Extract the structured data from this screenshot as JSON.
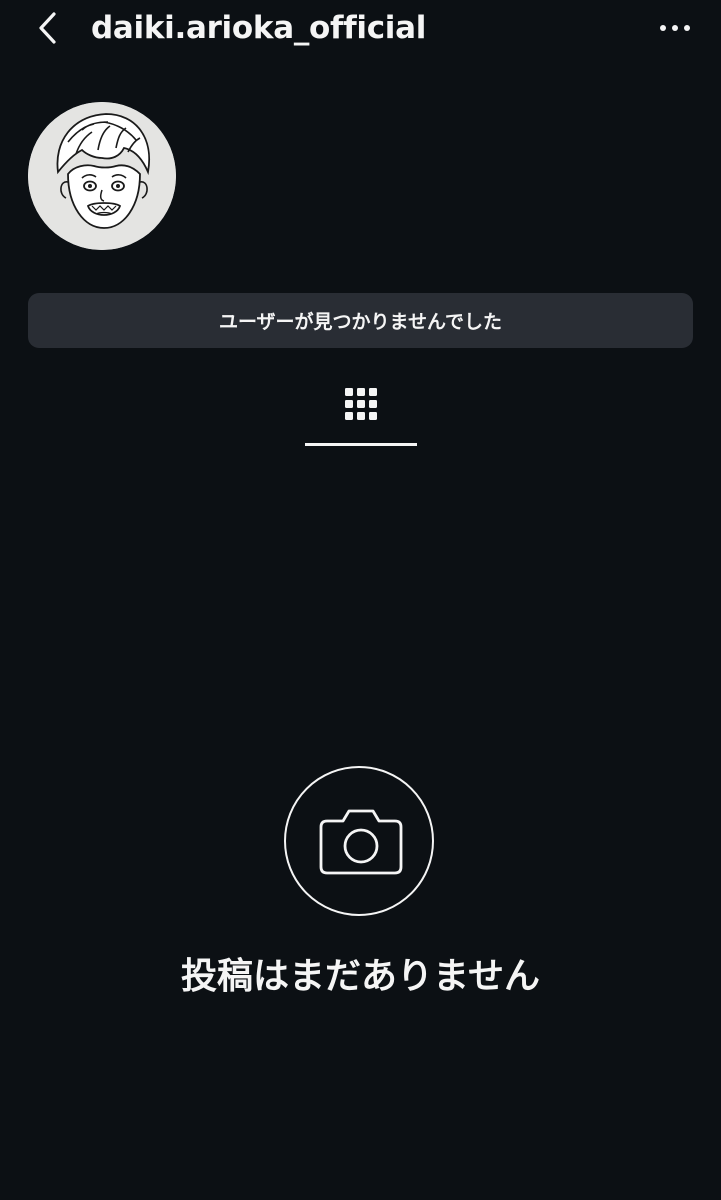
{
  "header": {
    "username": "daiki.arioka_official",
    "back_icon": "chevron-left-icon",
    "more_icon": "more-horizontal-icon"
  },
  "profile": {
    "avatar": "profile-avatar-illustration",
    "notice_button_label": "ユーザーが見つかりませんでした"
  },
  "tabs": {
    "active": "grid",
    "grid_icon": "grid-icon"
  },
  "empty_state": {
    "icon": "camera-icon",
    "message": "投稿はまだありません"
  },
  "colors": {
    "background": "#0c1014",
    "button_background": "#292d34",
    "text": "#f5f5f5"
  }
}
